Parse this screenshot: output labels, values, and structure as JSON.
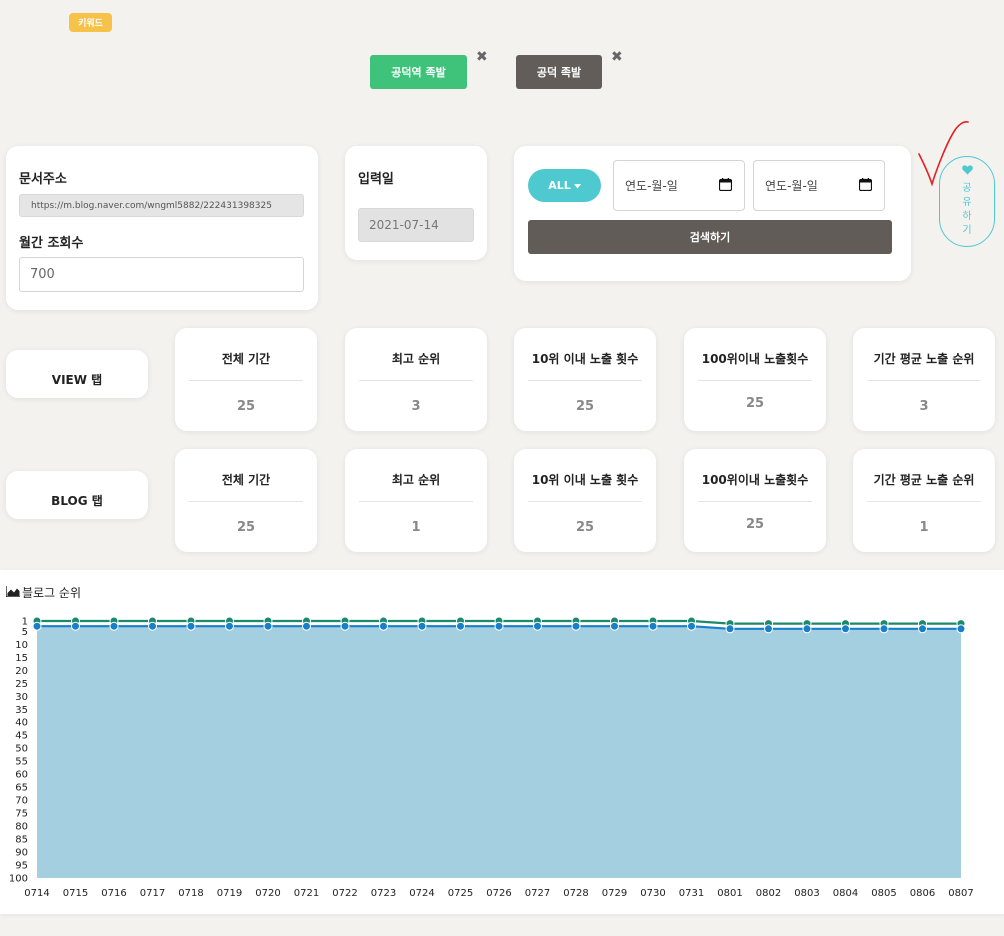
{
  "keyword_badge": "키워드",
  "keywords": [
    {
      "label": "공덕역 족발",
      "color": "#3fc27a",
      "remove": "✖"
    },
    {
      "label": "공덕 족발",
      "color": "#625d58",
      "remove": "✖"
    }
  ],
  "doc_info": {
    "url_label": "문서주소",
    "url_value": "https://m.blog.naver.com/wngml5882/222431398325",
    "views_label": "월간 조회수",
    "views_value": "700"
  },
  "input_date": {
    "label": "입력일",
    "value": "2021-07-14"
  },
  "filter": {
    "all_label": "ALL",
    "start_placeholder": "연도-월-일",
    "end_placeholder": "연도-월-일",
    "search_label": "검색하기"
  },
  "share": {
    "chars": [
      "공",
      "유",
      "하",
      "기"
    ],
    "accent": "#4fc9d0"
  },
  "stat_titles": [
    "전체 기간",
    "최고 순위",
    "10위 이내 노출 횟수",
    "100위이내 노출횟수",
    "기간 평균 노출 순위"
  ],
  "view_tab": {
    "label": "VIEW 탭",
    "values": [
      "25",
      "3",
      "25",
      "25",
      "3"
    ]
  },
  "blog_tab": {
    "label": "BLOG 탭",
    "values": [
      "25",
      "1",
      "25",
      "25",
      "1"
    ]
  },
  "chart_title": "블로그 순위",
  "chart_data": {
    "type": "area",
    "title": "블로그 순위",
    "categories": [
      "0714",
      "0715",
      "0716",
      "0717",
      "0718",
      "0719",
      "0720",
      "0721",
      "0722",
      "0723",
      "0724",
      "0725",
      "0726",
      "0727",
      "0728",
      "0729",
      "0730",
      "0731",
      "0801",
      "0802",
      "0803",
      "0804",
      "0805",
      "0806",
      "0807"
    ],
    "y_ticks": [
      1,
      5,
      10,
      15,
      20,
      25,
      30,
      35,
      40,
      45,
      50,
      55,
      60,
      65,
      70,
      75,
      80,
      85,
      90,
      95,
      100
    ],
    "ylim": [
      1,
      100
    ],
    "y_reversed": true,
    "series": [
      {
        "color": "#1a8a6a",
        "values": [
          1,
          1,
          1,
          1,
          1,
          1,
          1,
          1,
          1,
          1,
          1,
          1,
          1,
          1,
          1,
          1,
          1,
          1,
          2,
          2,
          2,
          2,
          2,
          2,
          2
        ]
      },
      {
        "color": "#1a7fc9",
        "values": [
          3,
          3,
          3,
          3,
          3,
          3,
          3,
          3,
          3,
          3,
          3,
          3,
          3,
          3,
          3,
          3,
          3,
          3,
          4,
          4,
          4,
          4,
          4,
          4,
          4
        ]
      }
    ],
    "fill_color": "#a3cfe0"
  }
}
